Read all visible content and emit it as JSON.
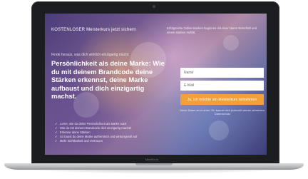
{
  "device": {
    "model_label": "MacBook"
  },
  "page": {
    "brand_text": "KOSTENLOSER Meisterkurs jetzt sichern",
    "top_text": "Erfolgreiche Online-Marken beginnen mit einer klaren Botschaft und einem starken Auftritt.",
    "subtitle": "Finde heraus, was dich wirklich einzigartig macht",
    "headline": "Persönlichkeit als deine Marke: Wie du mit deinem Brandcode deine Stärken erkennst, deine Marke aufbaust und dich einzigartig machst.",
    "bullets": [
      "Lerne, wie du deine Persönlichkeit als Marke nutzt",
      "Wie du mit deinem Brandcode dich einzigartig machst",
      "Erkenne deine Stärken",
      "So baust du deine Marke authentisch und wirkungsvoll auf",
      "Mehr Sichtbarkeit und Vertrauen"
    ],
    "form": {
      "name_placeholder": "Name",
      "email_placeholder": "E-Mail",
      "submit_label": "Ja, ich möchte am Meisterkurs teilnehmen",
      "disclaimer": "Deine Daten sind sicher. Du kannst dich jederzeit wieder abmelden. Datenschutz"
    }
  }
}
